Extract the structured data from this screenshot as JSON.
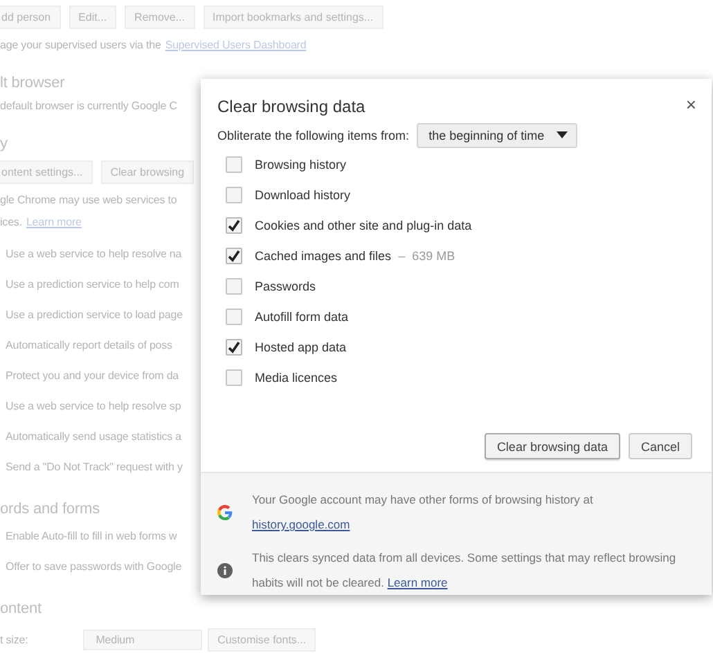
{
  "settings_page": {
    "items": [
      {
        "kind": "buttons",
        "buttons": [
          "dd person",
          "Edit...",
          "Remove...",
          "Import bookmarks and settings..."
        ]
      },
      {
        "kind": "text",
        "text": "age your supervised users via the",
        "link": "Supervised Users Dashboard"
      },
      {
        "kind": "heading",
        "text": "lt browser"
      },
      {
        "kind": "text",
        "text": "default browser is currently Google C"
      },
      {
        "kind": "heading",
        "text": "y"
      },
      {
        "kind": "buttons",
        "buttons": [
          "ontent settings...",
          "Clear browsing"
        ]
      },
      {
        "kind": "text",
        "text": "gle Chrome may use web services to"
      },
      {
        "kind": "text",
        "text": "ices.",
        "link": "Learn more"
      },
      {
        "kind": "option",
        "text": "Use a web service to help resolve na"
      },
      {
        "kind": "option",
        "text": "Use a prediction service to help com"
      },
      {
        "kind": "option",
        "text": "Use a prediction service to load page"
      },
      {
        "kind": "option",
        "text": "Automatically report details of poss"
      },
      {
        "kind": "option",
        "text": "Protect you and your device from da"
      },
      {
        "kind": "option",
        "text": "Use a web service to help resolve sp"
      },
      {
        "kind": "option",
        "text": "Automatically send usage statistics a"
      },
      {
        "kind": "option",
        "text": "Send a \"Do Not Track\" request with y"
      },
      {
        "kind": "heading",
        "text": "ords and forms"
      },
      {
        "kind": "option",
        "text": "Enable Auto-fill to fill in web forms w"
      },
      {
        "kind": "option",
        "text": "Offer to save passwords with Google"
      },
      {
        "kind": "heading",
        "text": "ontent"
      },
      {
        "kind": "field",
        "label": "t size:",
        "value": "Medium",
        "button": "Customise fonts..."
      }
    ]
  },
  "dialog": {
    "title": "Clear browsing data",
    "close": "×",
    "range_label": "Obliterate the following items from:",
    "range_value": "the beginning of time",
    "items": [
      {
        "label": "Browsing history",
        "checked": false
      },
      {
        "label": "Download history",
        "checked": false
      },
      {
        "label": "Cookies and other site and plug-in data",
        "checked": true
      },
      {
        "label": "Cached images and files",
        "detail": "–  639 MB",
        "checked": true
      },
      {
        "label": "Passwords",
        "checked": false
      },
      {
        "label": "Autofill form data",
        "checked": false
      },
      {
        "label": "Hosted app data",
        "checked": true
      },
      {
        "label": "Media licences",
        "checked": false
      }
    ],
    "buttons": [
      {
        "label": "Clear browsing data",
        "kind": "primary"
      },
      {
        "label": "Cancel",
        "kind": "secondary"
      }
    ],
    "notices": [
      {
        "kind": "google",
        "text": "Your Google account may have other forms of browsing history at",
        "link": "history.google.com"
      },
      {
        "kind": "info",
        "text": "This clears synced data from all devices. Some settings that may reflect browsing habits will not be cleared.",
        "link": "Learn more"
      }
    ]
  }
}
